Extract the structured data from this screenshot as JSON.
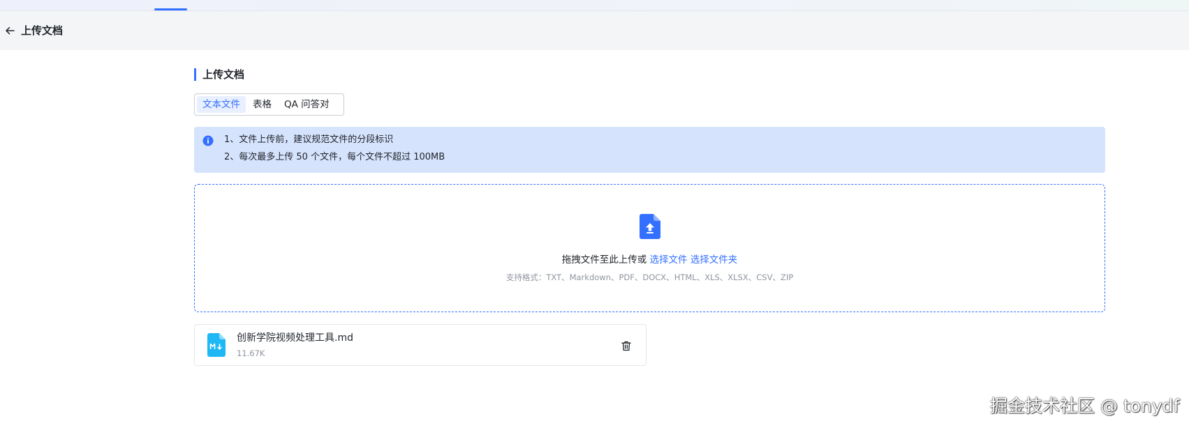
{
  "header": {
    "title": "上传文档"
  },
  "section": {
    "title": "上传文档"
  },
  "tabs": [
    {
      "label": "文本文件",
      "active": true
    },
    {
      "label": "表格",
      "active": false
    },
    {
      "label": "QA 问答对",
      "active": false
    }
  ],
  "notice": {
    "lines": [
      "1、文件上传前，建议规范文件的分段标识",
      "2、每次最多上传 50 个文件，每个文件不超过 100MB"
    ]
  },
  "dropzone": {
    "prompt": "拖拽文件至此上传或 ",
    "select_file": "选择文件",
    "select_folder": "选择文件夹",
    "formats": "支持格式：TXT、Markdown、PDF、DOCX、HTML、XLS、XLSX、CSV、ZIP"
  },
  "files": [
    {
      "name": "创新学院视频处理工具.md",
      "size": "11.67K"
    }
  ],
  "watermark": "掘金技术社区 @ tonydf",
  "colors": {
    "accent": "#3370ff",
    "notice_bg": "#d6e3fd",
    "file_icon": "#1fb8f5"
  },
  "icons": {
    "back": "arrow-left-icon",
    "info": "info-circle-icon",
    "upload": "file-upload-icon",
    "file": "markdown-file-icon",
    "delete": "trash-icon"
  }
}
